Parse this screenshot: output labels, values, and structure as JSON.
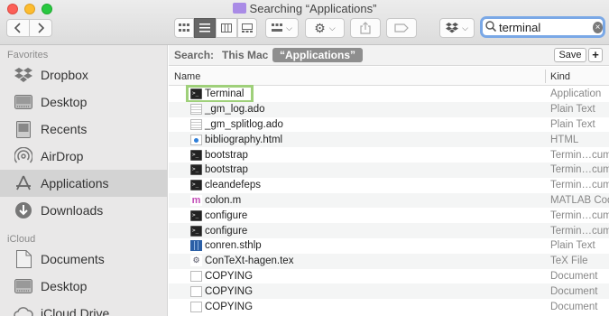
{
  "window": {
    "title": "Searching “Applications”"
  },
  "toolbar": {
    "back_icon": "chevron-left-icon",
    "forward_icon": "chevron-right-icon"
  },
  "search": {
    "value": "terminal",
    "clear_glyph": "×"
  },
  "sidebar": {
    "sections": [
      {
        "heading": "Favorites"
      },
      {
        "heading": "iCloud"
      }
    ],
    "favorites": [
      {
        "label": "Dropbox",
        "icon": "dropbox-icon"
      },
      {
        "label": "Desktop",
        "icon": "desktop-icon"
      },
      {
        "label": "Recents",
        "icon": "recents-icon"
      },
      {
        "label": "AirDrop",
        "icon": "airdrop-icon"
      },
      {
        "label": "Applications",
        "icon": "applications-icon",
        "active": true
      },
      {
        "label": "Downloads",
        "icon": "downloads-icon"
      }
    ],
    "icloud": [
      {
        "label": "Documents",
        "icon": "documents-icon"
      },
      {
        "label": "Desktop",
        "icon": "desktop-icon"
      },
      {
        "label": "iCloud Drive",
        "icon": "icloud-drive-icon"
      }
    ]
  },
  "scope": {
    "label": "Search:",
    "this_mac": "This Mac",
    "applications": "“Applications”",
    "save": "Save",
    "add": "+"
  },
  "columns": {
    "name": "Name",
    "kind": "Kind"
  },
  "files": [
    {
      "name": "Terminal",
      "kind": "Application",
      "icon": "terminal-icon"
    },
    {
      "name": "_gm_log.ado",
      "kind": "Plain Text",
      "icon": "text-file-icon"
    },
    {
      "name": "_gm_splitlog.ado",
      "kind": "Plain Text",
      "icon": "text-file-icon"
    },
    {
      "name": "bibliography.html",
      "kind": "HTML",
      "icon": "html-file-icon"
    },
    {
      "name": "bootstrap",
      "kind": "Termin…cument",
      "icon": "terminal-doc-icon"
    },
    {
      "name": "bootstrap",
      "kind": "Termin…cument",
      "icon": "terminal-doc-icon"
    },
    {
      "name": "cleandefeps",
      "kind": "Termin…cument",
      "icon": "terminal-doc-icon"
    },
    {
      "name": "colon.m",
      "kind": "MATLAB Code",
      "icon": "matlab-file-icon"
    },
    {
      "name": "configure",
      "kind": "Termin…cument",
      "icon": "terminal-doc-icon"
    },
    {
      "name": "configure",
      "kind": "Termin…cument",
      "icon": "terminal-doc-icon"
    },
    {
      "name": "conren.sthlp",
      "kind": "Plain Text",
      "icon": "stata-help-icon"
    },
    {
      "name": "ConTeXt-hagen.tex",
      "kind": "TeX File",
      "icon": "tex-file-icon"
    },
    {
      "name": "COPYING",
      "kind": "Document",
      "icon": "document-icon"
    },
    {
      "name": "COPYING",
      "kind": "Document",
      "icon": "document-icon"
    },
    {
      "name": "COPYING",
      "kind": "Document",
      "icon": "document-icon"
    }
  ]
}
